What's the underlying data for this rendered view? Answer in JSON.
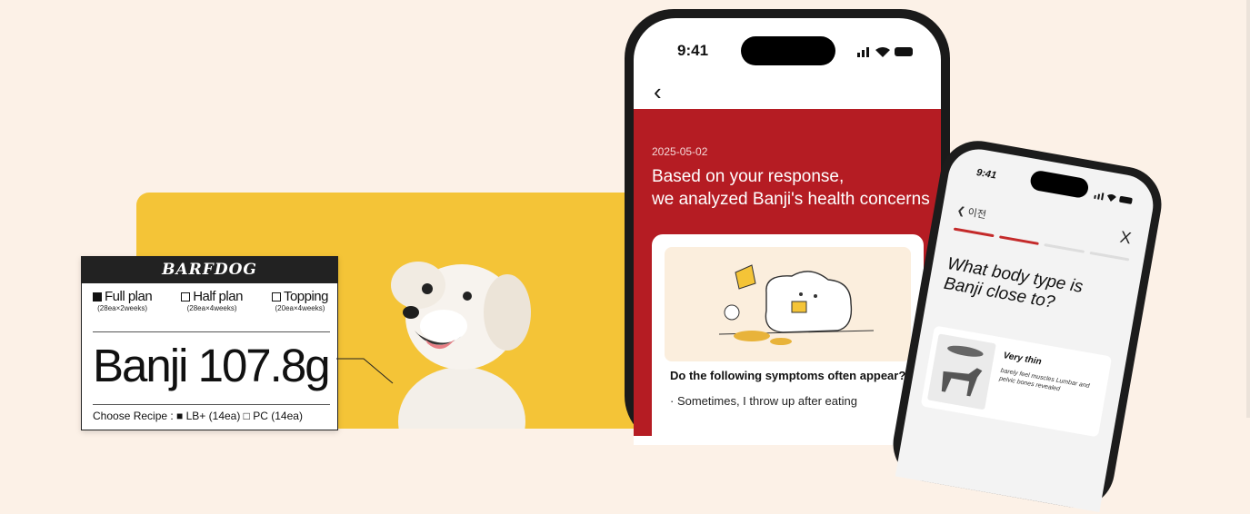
{
  "label": {
    "brand": "BARFDOG",
    "plans": [
      {
        "name": "Full plan",
        "sub": "(28ea×2weeks)",
        "selected": true
      },
      {
        "name": "Half plan",
        "sub": "(28ea×4weeks)",
        "selected": false
      },
      {
        "name": "Topping",
        "sub": "(20ea×4weeks)",
        "selected": false
      }
    ],
    "weight": "Banji 107.8g",
    "recipe": "Choose Recipe : ■ LB+ (14ea)  □ PC (14ea)"
  },
  "phone_main": {
    "time": "9:41",
    "back_glyph": "‹",
    "date": "2025-05-02",
    "title_line1": "Based on your response,",
    "title_line2": "we analyzed Banji's health concerns",
    "question": "Do the following symptoms often appear?",
    "answer": "· Sometimes, I throw up after eating",
    "accent_color": "#b51c23"
  },
  "phone_small": {
    "time": "9:41",
    "back_label": "이전",
    "close_glyph": "X",
    "progress_step": 2,
    "progress_total": 4,
    "question_line1": "What body type is",
    "question_line2": "Banji close to?",
    "option_title": "Very thin",
    "option_desc": "barely feel muscles Lumbar and pelvic bones revealed"
  },
  "colors": {
    "background": "#fcf1e7",
    "yellow": "#f4c437",
    "progress_active": "#c42a2a"
  }
}
